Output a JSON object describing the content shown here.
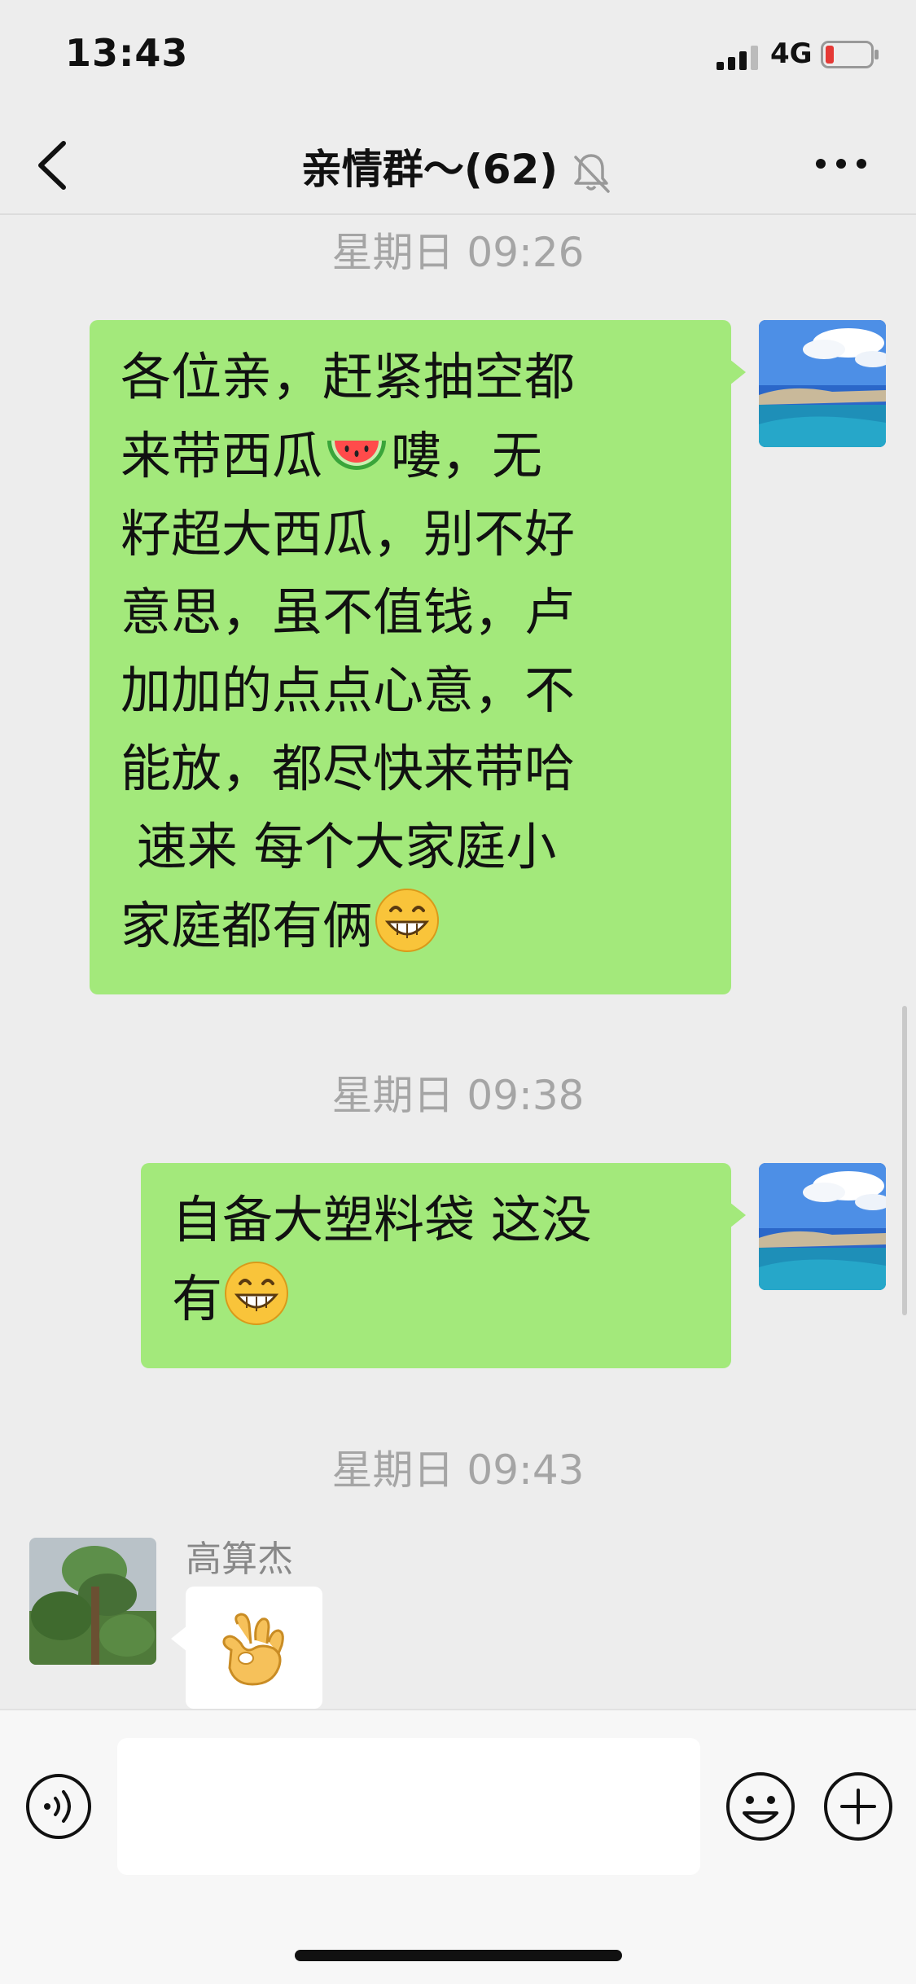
{
  "status_bar": {
    "time": "13:43",
    "network": "4G"
  },
  "nav": {
    "title": "亲情群～(62)"
  },
  "messages": [
    {
      "timestamp": "星期日 09:26",
      "lines": [
        "各位亲，赶紧抽空都",
        "来带西瓜",
        "嘍，无",
        "籽超大西瓜，别不好",
        "意思，虽不值钱，卢",
        "加加的点点心意，不",
        "能放，都尽快来带哈",
        " 速来 每个大家庭小",
        "家庭都有俩"
      ]
    },
    {
      "timestamp": "星期日 09:38",
      "lines": [
        "自备大塑料袋 这没",
        "有"
      ]
    },
    {
      "timestamp": "星期日 09:43",
      "sender": "高算杰"
    }
  ],
  "input": {
    "placeholder": ""
  },
  "colors": {
    "bubble_me": "#a3e97b",
    "background": "#ededed"
  }
}
